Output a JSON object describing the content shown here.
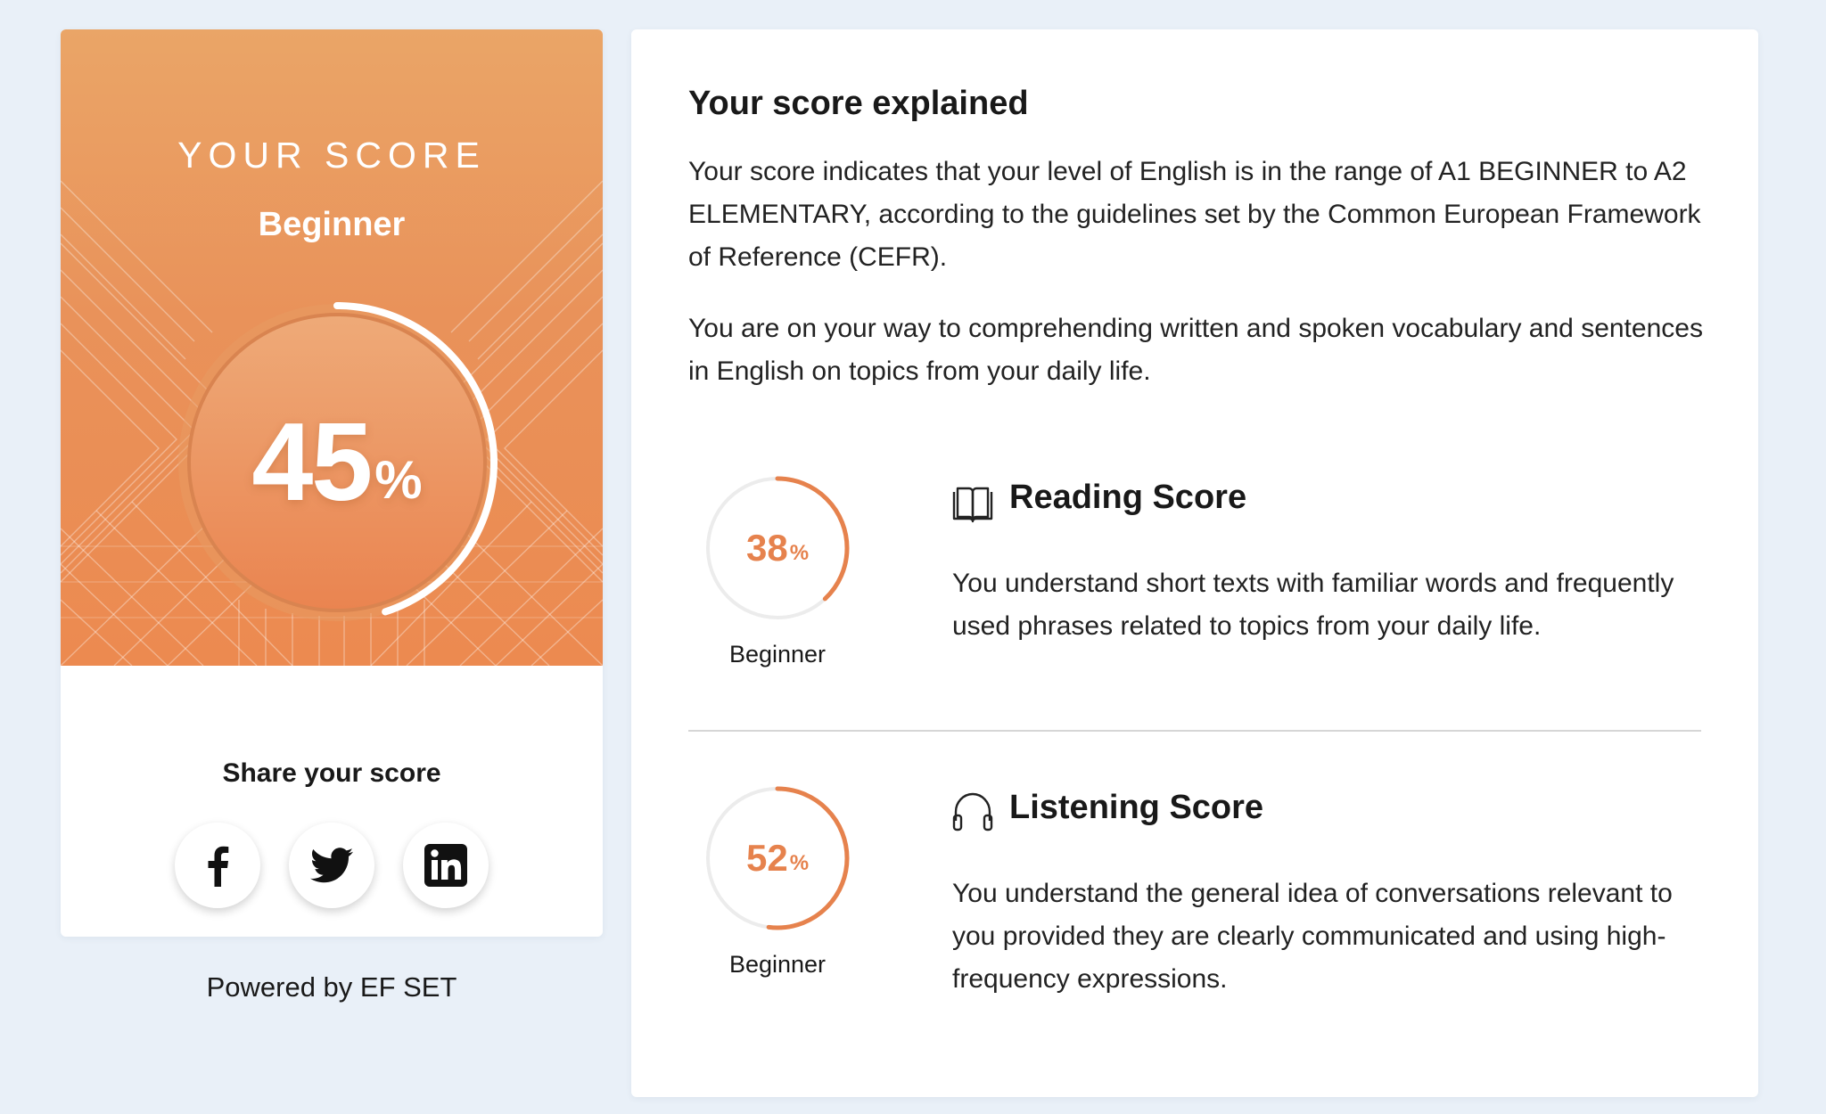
{
  "score_card": {
    "title": "YOUR SCORE",
    "level": "Beginner",
    "overall_percent": 45,
    "overall_value": "45",
    "percent_sign": "%",
    "share_title": "Share your score",
    "share_buttons": [
      {
        "network": "facebook",
        "icon": "facebook-icon"
      },
      {
        "network": "twitter",
        "icon": "twitter-icon"
      },
      {
        "network": "linkedin",
        "icon": "linkedin-icon"
      }
    ]
  },
  "footer": {
    "powered_by": "Powered by EF SET"
  },
  "explanation": {
    "title": "Your score explained",
    "paragraph1": "Your score indicates that your level of English is in the range of A1 BEGINNER to A2 ELEMENTARY, according to the guidelines set by the Common European Framework of Reference (CEFR).",
    "paragraph2": "You are on your way to comprehending written and spoken vocabulary and sentences in English on topics from your daily life."
  },
  "sections": [
    {
      "title": "Reading Score",
      "icon": "book-icon",
      "percent": 38,
      "value": "38",
      "percent_sign": "%",
      "level": "Beginner",
      "description": "You understand short texts with familiar words and frequently used phrases related to topics from your daily life."
    },
    {
      "title": "Listening Score",
      "icon": "headphones-icon",
      "percent": 52,
      "value": "52",
      "percent_sign": "%",
      "level": "Beginner",
      "description": "You understand the general idea of conversations relevant to you provided they are clearly communicated and using high-frequency expressions."
    }
  ],
  "colors": {
    "accent": "#e6824d",
    "hero_top": "#eaa567",
    "hero_bottom": "#ec8a50",
    "background": "#e9f0f8"
  }
}
